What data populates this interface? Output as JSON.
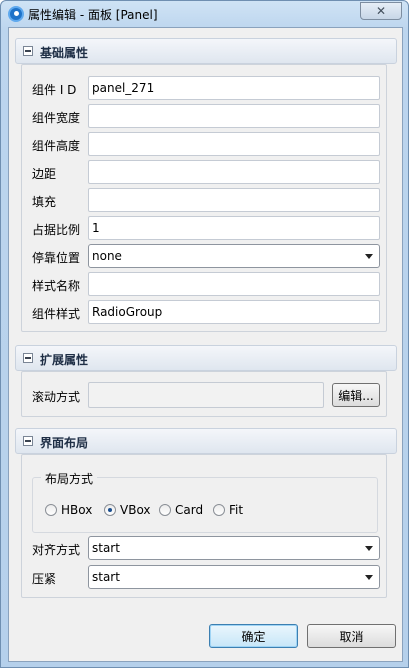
{
  "window": {
    "title": "属性编辑 - 面板 [Panel]",
    "close_symbol": "✕"
  },
  "sections": {
    "basic": {
      "header": "基础属性",
      "rows": [
        {
          "label": "组件 I D",
          "value": "panel_271",
          "kind": "input"
        },
        {
          "label": "组件宽度",
          "value": "",
          "kind": "input"
        },
        {
          "label": "组件高度",
          "value": "",
          "kind": "input"
        },
        {
          "label": "边距",
          "value": "",
          "kind": "input"
        },
        {
          "label": "填充",
          "value": "",
          "kind": "input"
        },
        {
          "label": "占据比例",
          "value": "1",
          "kind": "input"
        },
        {
          "label": "停靠位置",
          "value": "none",
          "kind": "select"
        },
        {
          "label": "样式名称",
          "value": "",
          "kind": "input"
        },
        {
          "label": "组件样式",
          "value": "RadioGroup",
          "kind": "input"
        }
      ]
    },
    "extended": {
      "header": "扩展属性",
      "scroll_label": "滚动方式",
      "scroll_value": "",
      "edit_button": "编辑..."
    },
    "layout": {
      "header": "界面布局",
      "group_title": "布局方式",
      "options": [
        "HBox",
        "VBox",
        "Card",
        "Fit"
      ],
      "selected": "VBox",
      "align_label": "对齐方式",
      "align_value": "start",
      "pack_label": "压紧",
      "pack_value": "start"
    }
  },
  "footer": {
    "ok_label": "确定",
    "cancel_label": "取消"
  }
}
